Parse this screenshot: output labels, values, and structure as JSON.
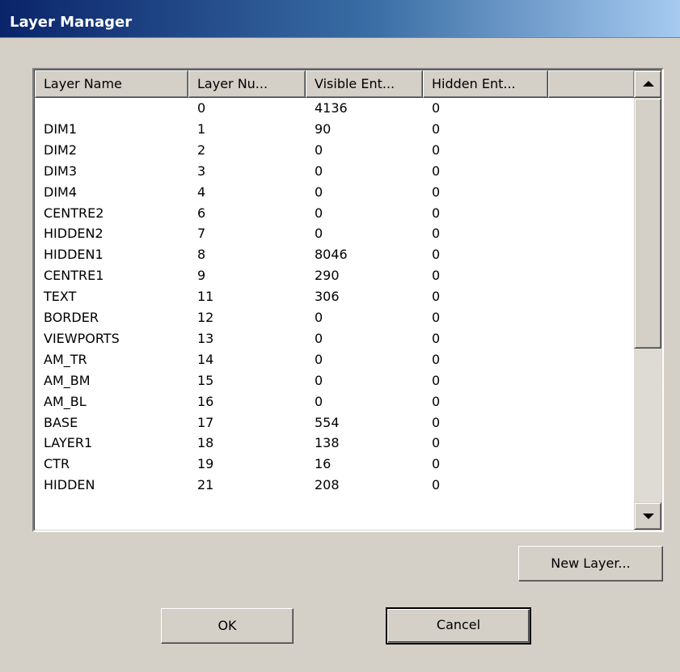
{
  "window": {
    "title": "Layer Manager"
  },
  "table": {
    "columns": [
      "Layer Name",
      "Layer Nu...",
      "Visible Ent...",
      "Hidden Ent..."
    ],
    "rows": [
      [
        "",
        "0",
        "4136",
        "0"
      ],
      [
        "DIM1",
        "1",
        "90",
        "0"
      ],
      [
        "DIM2",
        "2",
        "0",
        "0"
      ],
      [
        "DIM3",
        "3",
        "0",
        "0"
      ],
      [
        "DIM4",
        "4",
        "0",
        "0"
      ],
      [
        "CENTRE2",
        "6",
        "0",
        "0"
      ],
      [
        "HIDDEN2",
        "7",
        "0",
        "0"
      ],
      [
        "HIDDEN1",
        "8",
        "8046",
        "0"
      ],
      [
        "CENTRE1",
        "9",
        "290",
        "0"
      ],
      [
        "TEXT",
        "11",
        "306",
        "0"
      ],
      [
        "BORDER",
        "12",
        "0",
        "0"
      ],
      [
        "VIEWPORTS",
        "13",
        "0",
        "0"
      ],
      [
        "AM_TR",
        "14",
        "0",
        "0"
      ],
      [
        "AM_BM",
        "15",
        "0",
        "0"
      ],
      [
        "AM_BL",
        "16",
        "0",
        "0"
      ],
      [
        "BASE",
        "17",
        "554",
        "0"
      ],
      [
        "LAYER1",
        "18",
        "138",
        "0"
      ],
      [
        "CTR",
        "19",
        "16",
        "0"
      ],
      [
        "HIDDEN",
        "21",
        "208",
        "0"
      ]
    ]
  },
  "buttons": {
    "new_layer": "New Layer...",
    "ok": "OK",
    "cancel": "Cancel"
  },
  "colors": {
    "titlebar_start": "#0a246a",
    "titlebar_end": "#a6caf0",
    "dialog_face": "#d4d0c8"
  }
}
